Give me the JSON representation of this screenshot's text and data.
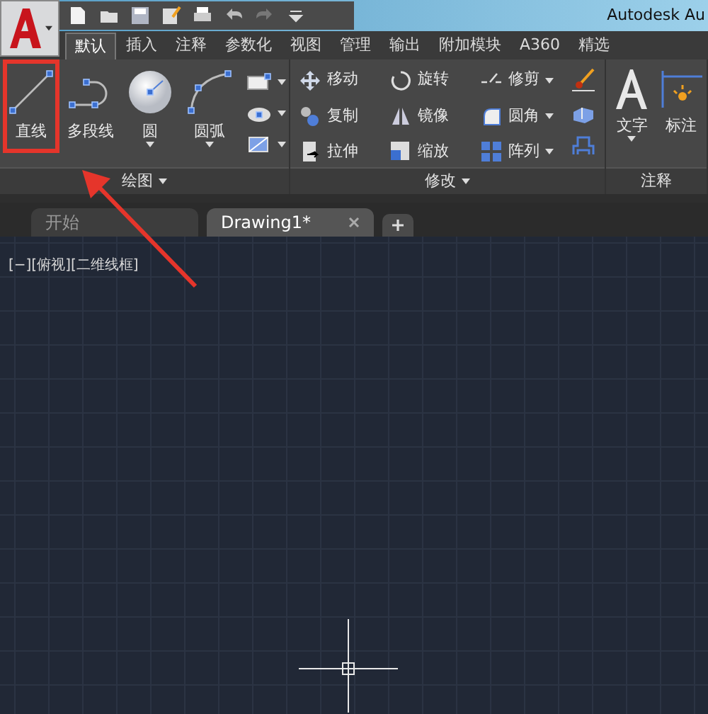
{
  "window": {
    "title": "Autodesk Au"
  },
  "ribbon_tabs": [
    {
      "label": "默认",
      "selected": true
    },
    {
      "label": "插入",
      "selected": false
    },
    {
      "label": "注释",
      "selected": false
    },
    {
      "label": "参数化",
      "selected": false
    },
    {
      "label": "视图",
      "selected": false
    },
    {
      "label": "管理",
      "selected": false
    },
    {
      "label": "输出",
      "selected": false
    },
    {
      "label": "附加模块",
      "selected": false
    },
    {
      "label": "A360",
      "selected": false
    },
    {
      "label": "精选",
      "selected": false
    }
  ],
  "panels": [
    {
      "title": "绘图",
      "kind": "draw",
      "tools": [
        {
          "label": "直线",
          "dropdown": false,
          "highlighted": true
        },
        {
          "label": "多段线",
          "dropdown": false,
          "highlighted": false
        },
        {
          "label": "圆",
          "dropdown": true,
          "highlighted": false
        },
        {
          "label": "圆弧",
          "dropdown": true,
          "highlighted": false
        }
      ]
    },
    {
      "title": "修改",
      "kind": "modify",
      "tools": [
        {
          "label": "移动",
          "dropdown": false
        },
        {
          "label": "旋转",
          "dropdown": false
        },
        {
          "label": "修剪",
          "dropdown": true
        },
        {
          "label": "复制",
          "dropdown": false
        },
        {
          "label": "镜像",
          "dropdown": false
        },
        {
          "label": "圆角",
          "dropdown": true
        },
        {
          "label": "拉伸",
          "dropdown": false
        },
        {
          "label": "缩放",
          "dropdown": false
        },
        {
          "label": "阵列",
          "dropdown": true
        }
      ]
    },
    {
      "title": "注释",
      "kind": "annotate",
      "tools": [
        {
          "label": "文字",
          "dropdown": true
        },
        {
          "label": "标注",
          "dropdown": false
        }
      ]
    }
  ],
  "doc_tabs": [
    {
      "label": "开始",
      "selected": false,
      "closable": false
    },
    {
      "label": "Drawing1*",
      "selected": true,
      "closable": true
    }
  ],
  "viewport_label": "[−][俯视][二维线框]"
}
